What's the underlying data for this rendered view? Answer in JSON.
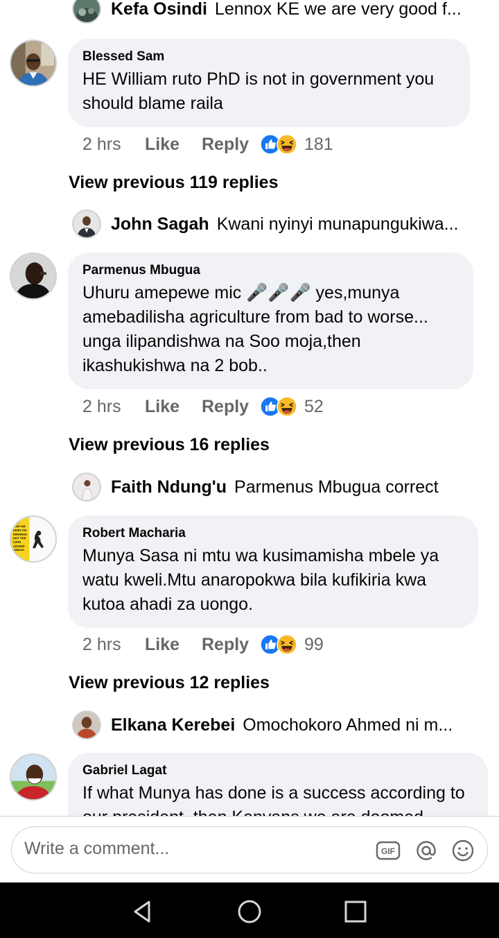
{
  "comments": [
    {
      "preview": {
        "name": "Kefa Osindi",
        "text": "Lennox KE we are very good f..."
      }
    },
    {
      "author": "Blessed Sam",
      "text": "HE William ruto PhD is not in government you should blame raila",
      "time": "2 hrs",
      "like_label": "Like",
      "reply_label": "Reply",
      "reaction_count": "181",
      "view_previous": "View previous 119 replies",
      "preview": {
        "name": "John Sagah",
        "text": "Kwani nyinyi munapungukiwa..."
      }
    },
    {
      "author": "Parmenus Mbugua",
      "text": "Uhuru amepewe mic 🎤🎤🎤 yes,munya amebadilisha agriculture from bad to worse... unga ilipandishwa na Soo moja,then ikashukishwa na 2 bob..",
      "time": "2 hrs",
      "like_label": "Like",
      "reply_label": "Reply",
      "reaction_count": "52",
      "view_previous": "View previous 16 replies",
      "preview": {
        "name": "Faith Ndung'u",
        "text": "Parmenus Mbugua correct"
      }
    },
    {
      "author": "Robert Macharia",
      "text": "Munya Sasa ni mtu wa kusimamisha mbele ya watu kweli.Mtu anaropokwa bila kufikiria kwa kutoa ahadi za uongo.",
      "time": "2 hrs",
      "like_label": "Like",
      "reply_label": "Reply",
      "reaction_count": "99",
      "view_previous": "View previous 12 replies",
      "preview": {
        "name": "Elkana Kerebei",
        "text": "Omochokoro  Ahmed ni m..."
      }
    },
    {
      "author": "Gabriel Lagat",
      "text": "If what Munya has done is a success according to our president, then Kenyans we are doomed"
    }
  ],
  "composer": {
    "placeholder": "Write a comment...",
    "gif_label": "GIF",
    "icons": [
      "gif-icon",
      "mention-icon",
      "emoji-icon"
    ]
  },
  "navbar": {
    "icons": [
      "back-triangle-icon",
      "home-circle-icon",
      "recents-square-icon"
    ]
  },
  "colors": {
    "bubble": "#f0f2f5",
    "meta_text": "#65676b",
    "like_blue": "#1877f2",
    "haha_yellow": "#f7b928",
    "navbar": "#000000"
  },
  "avatar_texts": {
    "robert_macharia_poster": [
      "THE",
      "...DE WE",
      "SEND ON",
      "ERRANDS",
      "NOT THE",
      "LONG",
      "LEGGED",
      "'ORICHI"
    ]
  }
}
